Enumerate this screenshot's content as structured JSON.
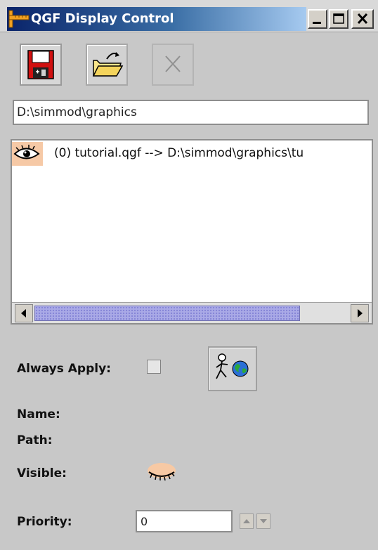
{
  "window": {
    "title": "QGF Display Control",
    "icons": {
      "app": "ruler-icon",
      "minimize": "minimize-icon",
      "maximize": "maximize-icon",
      "close": "close-icon"
    }
  },
  "toolbar": {
    "buttons": [
      {
        "name": "save",
        "icon": "floppy-disk-icon"
      },
      {
        "name": "open",
        "icon": "open-folder-icon"
      },
      {
        "name": "delete",
        "icon": "x-icon",
        "enabled": false
      }
    ]
  },
  "path_field": {
    "value": "D:\\simmod\\graphics"
  },
  "file_list": {
    "items": [
      {
        "icon": "eye-open-icon",
        "label": "(0) tutorial.qgf --> D:\\simmod\\graphics\\tu"
      }
    ],
    "scrollbar": {
      "icons": [
        "scroll-left-icon",
        "scroll-right-icon"
      ]
    }
  },
  "properties": {
    "always_apply_label": "Always Apply:",
    "always_apply_checked": false,
    "apply_icon": "walker-globe-icon",
    "name_label": "Name:",
    "path_label": "Path:",
    "visible_label": "Visible:",
    "visible_icon": "eye-closed-icon",
    "priority_label": "Priority:",
    "priority_value": "0"
  },
  "colors": {
    "window_bg": "#c8c8c8",
    "title_gradient_start": "#0a246a",
    "title_gradient_end": "#a6caf0",
    "scroll_thumb": "#a9a9e6",
    "eye_icon_bg": "#f6c9a6"
  }
}
